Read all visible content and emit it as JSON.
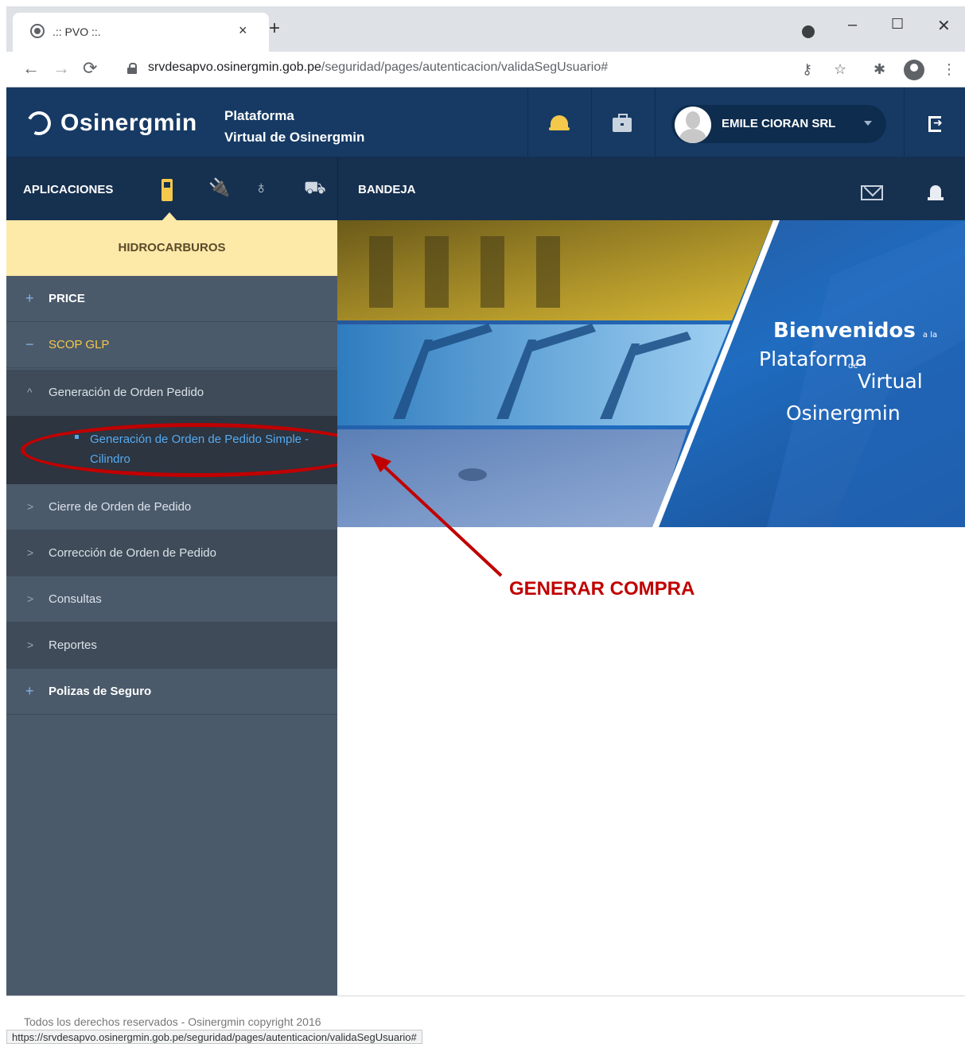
{
  "browser": {
    "tab_title": ".:: PVO ::.",
    "tab_close": "×",
    "new_tab": "+",
    "window_buttons": [
      "–",
      "☐",
      "✕"
    ],
    "url_host": "srvdesapvo.osinergmin.gob.pe",
    "url_path": "/seguridad/pages/autenticacion/validaSegUsuario#",
    "status_url": "https://srvdesapvo.osinergmin.gob.pe/seguridad/pages/autenticacion/validaSegUsuario#"
  },
  "header": {
    "logo_text": "Osinergmin",
    "platform_line1": "Plataforma",
    "platform_line2": "Virtual de Osinergmin",
    "user_name": "EMILE CIORAN SRL"
  },
  "nav": {
    "apps_label": "APLICACIONES",
    "bandeja_label": "BANDEJA"
  },
  "sidebar": {
    "section_title": "HIDROCARBUROS",
    "items": [
      {
        "sign": "+",
        "label": "PRICE"
      },
      {
        "sign": "−",
        "label": "SCOP GLP"
      },
      {
        "sign": "^",
        "label": "Generación de Orden Pedido"
      },
      {
        "sub_label": "Generación de Orden de Pedido Simple - Cilindro"
      },
      {
        "sign": ">",
        "label": "Cierre de Orden de Pedido"
      },
      {
        "sign": ">",
        "label": "Corrección de Orden de Pedido"
      },
      {
        "sign": ">",
        "label": "Consultas"
      },
      {
        "sign": ">",
        "label": "Reportes"
      },
      {
        "sign": "+",
        "label": "Polizas de Seguro"
      }
    ]
  },
  "banner": {
    "line1": "Bienvenidos",
    "line1_small": "a la",
    "line2": "Plataforma",
    "line3": "Virtual",
    "line3_small": "de",
    "line4": "Osinergmin"
  },
  "annotation": {
    "text": "GENERAR COMPRA"
  },
  "footer": {
    "copyright": "Todos los derechos reservados - Osinergmin copyright 2016"
  },
  "colors": {
    "header_bg": "#163a64",
    "nav_bg": "#16304f",
    "sidebar_bg": "#4b5a6b",
    "accent_yellow": "#fde9a8",
    "annotation_red": "#c00000",
    "link_blue": "#56aaf0"
  }
}
